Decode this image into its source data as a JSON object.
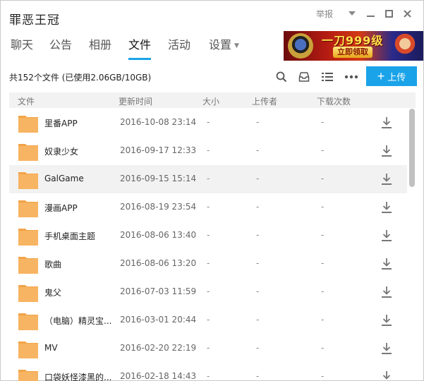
{
  "window": {
    "title": "罪恶王冠",
    "report_label": "举报"
  },
  "tabs": [
    {
      "label": "聊天"
    },
    {
      "label": "公告"
    },
    {
      "label": "相册"
    },
    {
      "label": "文件"
    },
    {
      "label": "活动"
    },
    {
      "label": "设置"
    }
  ],
  "active_tab": "文件",
  "ad": {
    "headline": "一刀999级",
    "button_label": "立即领取"
  },
  "toolbar": {
    "summary": "共152个文件 (已使用2.06GB/10GB)",
    "upload_label": "上传",
    "icons": [
      "search-icon",
      "inbox-icon",
      "list-view-icon",
      "more-icon"
    ]
  },
  "columns": {
    "name": "文件",
    "time": "更新时间",
    "size": "大小",
    "uploader": "上传者",
    "downloads": "下载次数"
  },
  "files": [
    {
      "name": "里番APP",
      "time": "2016-10-08 23:14",
      "size": "-",
      "uploader": "-",
      "downloads": "-"
    },
    {
      "name": "奴隶少女",
      "time": "2016-09-17 12:33",
      "size": "-",
      "uploader": "-",
      "downloads": "-"
    },
    {
      "name": "GalGame",
      "time": "2016-09-15 15:14",
      "size": "-",
      "uploader": "-",
      "downloads": "-"
    },
    {
      "name": "漫画APP",
      "time": "2016-08-19 23:54",
      "size": "-",
      "uploader": "-",
      "downloads": "-"
    },
    {
      "name": "手机桌面主题",
      "time": "2016-08-06 13:40",
      "size": "-",
      "uploader": "-",
      "downloads": "-"
    },
    {
      "name": "歌曲",
      "time": "2016-08-06 13:20",
      "size": "-",
      "uploader": "-",
      "downloads": "-"
    },
    {
      "name": "鬼父",
      "time": "2016-07-03 11:59",
      "size": "-",
      "uploader": "-",
      "downloads": "-"
    },
    {
      "name": "（电脑）精灵宝...",
      "time": "2016-03-01 20:44",
      "size": "-",
      "uploader": "-",
      "downloads": "-"
    },
    {
      "name": "MV",
      "time": "2016-02-20 22:19",
      "size": "-",
      "uploader": "-",
      "downloads": "-"
    },
    {
      "name": "口袋妖怪漆黑的...",
      "time": "2016-02-18 14:43",
      "size": "-",
      "uploader": "-",
      "downloads": "-"
    }
  ],
  "colors": {
    "accent": "#1aa3e8",
    "folder": "#f7b462",
    "folder_tab": "#f2a449",
    "hover_row": "#f2f2f2"
  }
}
